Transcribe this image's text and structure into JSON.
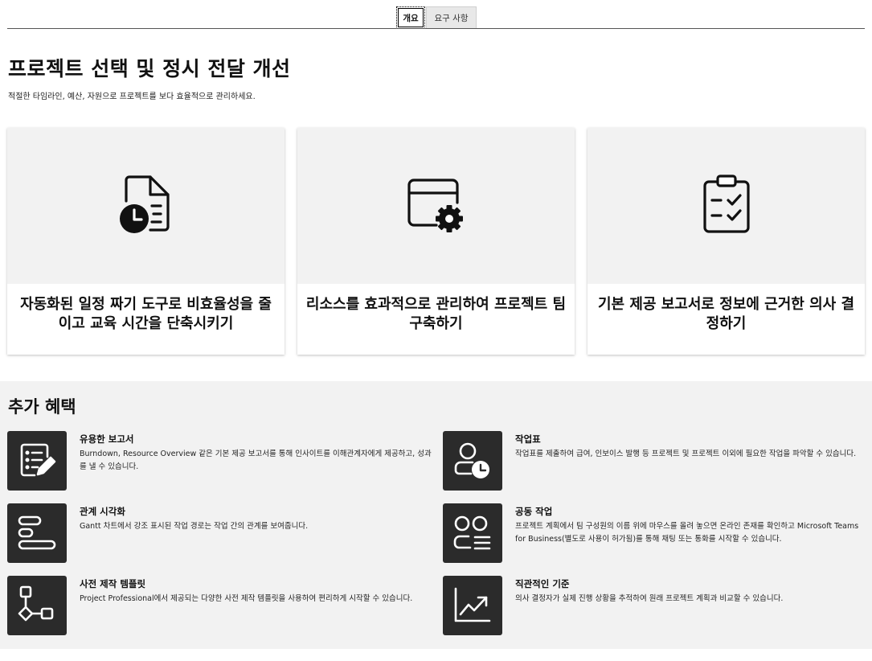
{
  "tabs": [
    {
      "label": "개요",
      "selected": true
    },
    {
      "label": "요구 사항",
      "selected": false
    }
  ],
  "hero": {
    "title": "프로젝트 선택 및 정시 전달 개선",
    "subtitle": "적절한 타임라인, 예산, 자원으로 프로젝트를 보다 효율적으로 관리하세요."
  },
  "cards": [
    {
      "icon": "document-clock-icon",
      "title": "자동화된 일정 짜기 도구로 비효율성을 줄이고 교육 시간을 단축시키기"
    },
    {
      "icon": "window-gear-icon",
      "title": "리소스를 효과적으로 관리하여 프로젝트 팀 구축하기"
    },
    {
      "icon": "clipboard-checklist-icon",
      "title": "기본 제공 보고서로 정보에 근거한 의사 결정하기"
    }
  ],
  "benefits": {
    "title": "추가 혜택",
    "items": [
      {
        "icon": "report-edit-icon",
        "title": "유용한 보고서",
        "description": "Burndown, Resource Overview 같은 기본 제공 보고서를 통해 인사이트를 이해관계자에게 제공하고, 성과를 낼 수 있습니다."
      },
      {
        "icon": "person-clock-icon",
        "title": "작업표",
        "description": "작업표를 제출하여 급여, 인보이스 발행 등 프로젝트 및 프로젝트 이외에 필요한 작업을 파악할 수 있습니다."
      },
      {
        "icon": "gantt-bars-icon",
        "title": "관계 시각화",
        "description": "Gantt 차트에서 강조 표시된 작업 경로는 작업 간의 관계를 보여줍니다."
      },
      {
        "icon": "people-list-icon",
        "title": "공동 작업",
        "description": "프로젝트 계획에서 팀 구성원의 이름 위에 마우스를 올려 놓으면 온라인 존재를 확인하고 Microsoft Teams for Business(별도로 사용이 허가됨)를 통해 채팅 또는 통화를 시작할 수 있습니다."
      },
      {
        "icon": "flowchart-icon",
        "title": "사전 제작 템플릿",
        "description": "Project Professional에서 제공되는 다양한 사전 제작 템플릿을 사용하여 편리하게 시작할 수 있습니다."
      },
      {
        "icon": "trending-chart-icon",
        "title": "직관적인 기준",
        "description": "의사 결정자가 실제 진행 상황을 추적하여 원래 프로젝트 계획과 비교할 수 있습니다."
      }
    ]
  }
}
